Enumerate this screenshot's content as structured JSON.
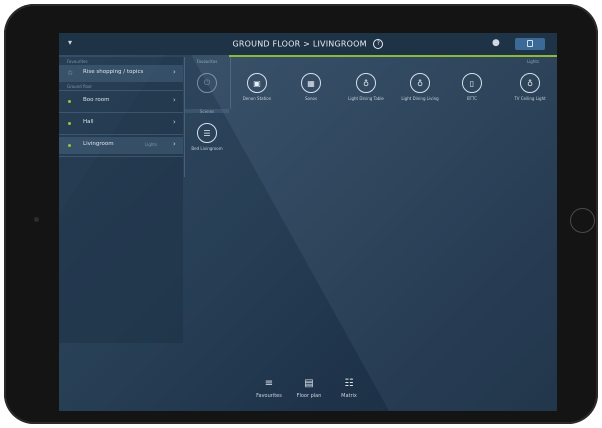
{
  "header": {
    "title": "GROUND FLOOR > LIVINGROOM",
    "help_glyph": "?"
  },
  "sidebar": {
    "section_top": "Favourites",
    "favourite_item": {
      "label": "Rise shopping / topics",
      "icon": "star-icon"
    },
    "section_rooms": "Ground floor",
    "items": [
      {
        "label": "Boo room",
        "meta": ""
      },
      {
        "label": "Hall",
        "meta": ""
      },
      {
        "label": "Livingroom",
        "meta": "Lights"
      }
    ]
  },
  "columns": {
    "left_header": "Favourites",
    "right_header": "Lights",
    "section_label": "Scenes"
  },
  "devices": [
    {
      "label": "Denon Station",
      "icon": "speaker-icon",
      "glyph": "▣"
    },
    {
      "label": "Sonos",
      "icon": "sonos-icon",
      "glyph": "▦"
    },
    {
      "label": "Light Dining Table",
      "icon": "bulb-icon",
      "glyph": "♁"
    },
    {
      "label": "Light Dining Living",
      "icon": "bulb-icon",
      "glyph": "♁"
    },
    {
      "label": "BTTC",
      "icon": "remote-icon",
      "glyph": "▯"
    },
    {
      "label": "TV Ceiling Light",
      "icon": "bulb-icon",
      "glyph": "♁"
    }
  ],
  "favourite_device": {
    "label": "",
    "glyph": "⏻"
  },
  "scene_device": {
    "label": "Bed Livingroom",
    "glyph": "☰"
  },
  "bottom_nav": [
    {
      "label": "Favourites",
      "icon": "favourites-icon",
      "glyph": "≡"
    },
    {
      "label": "Floor plan",
      "icon": "floorplan-icon",
      "glyph": "▤"
    },
    {
      "label": "Matrix",
      "icon": "matrix-icon",
      "glyph": "☷"
    }
  ],
  "colors": {
    "accent_green": "#8fb83a",
    "background": "#2b445c",
    "button_blue": "#3a6a95"
  }
}
